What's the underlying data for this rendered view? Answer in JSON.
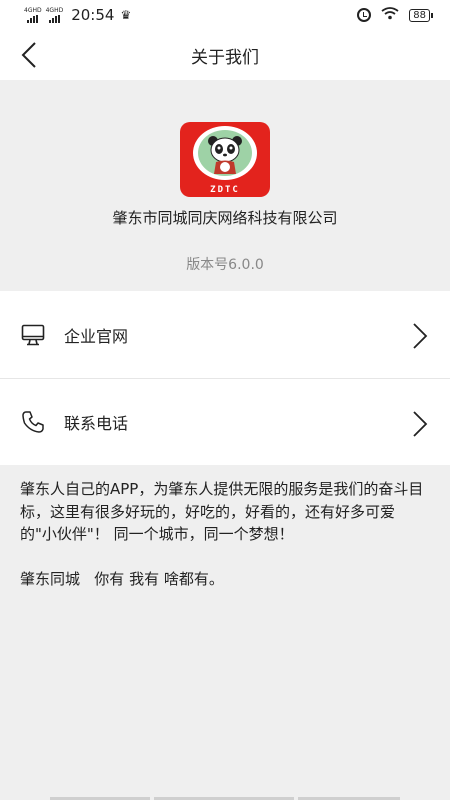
{
  "status_bar": {
    "signal1_label": "4GHD",
    "signal2_label": "4GHD",
    "time": "20:54",
    "crown_icon": "♛",
    "wifi_icon": "wifi",
    "battery": "88"
  },
  "header": {
    "title": "关于我们",
    "back_icon": "chevron-left-icon"
  },
  "app": {
    "logo_text": "ZDTC",
    "company_name": "肇东市同城同庆网络科技有限公司",
    "version": "版本号6.0.0"
  },
  "menu": {
    "items": [
      {
        "label": "企业官网",
        "icon": "monitor-icon"
      },
      {
        "label": "联系电话",
        "icon": "phone-icon"
      }
    ]
  },
  "about": {
    "paragraph1": "肇东人自己的APP，为肇东人提供无限的服务是我们的奋斗目标，这里有很多好玩的，好吃的，好看的，还有好多可爱的\"小伙伴\"！ 同一个城市，同一个梦想！",
    "paragraph2": "肇东同城   你有 我有 啥都有。"
  },
  "colors": {
    "logo_red": "#e3231d",
    "logo_green": "#9ed2a6",
    "page_bg": "#efefef",
    "version_gray": "#888888"
  }
}
